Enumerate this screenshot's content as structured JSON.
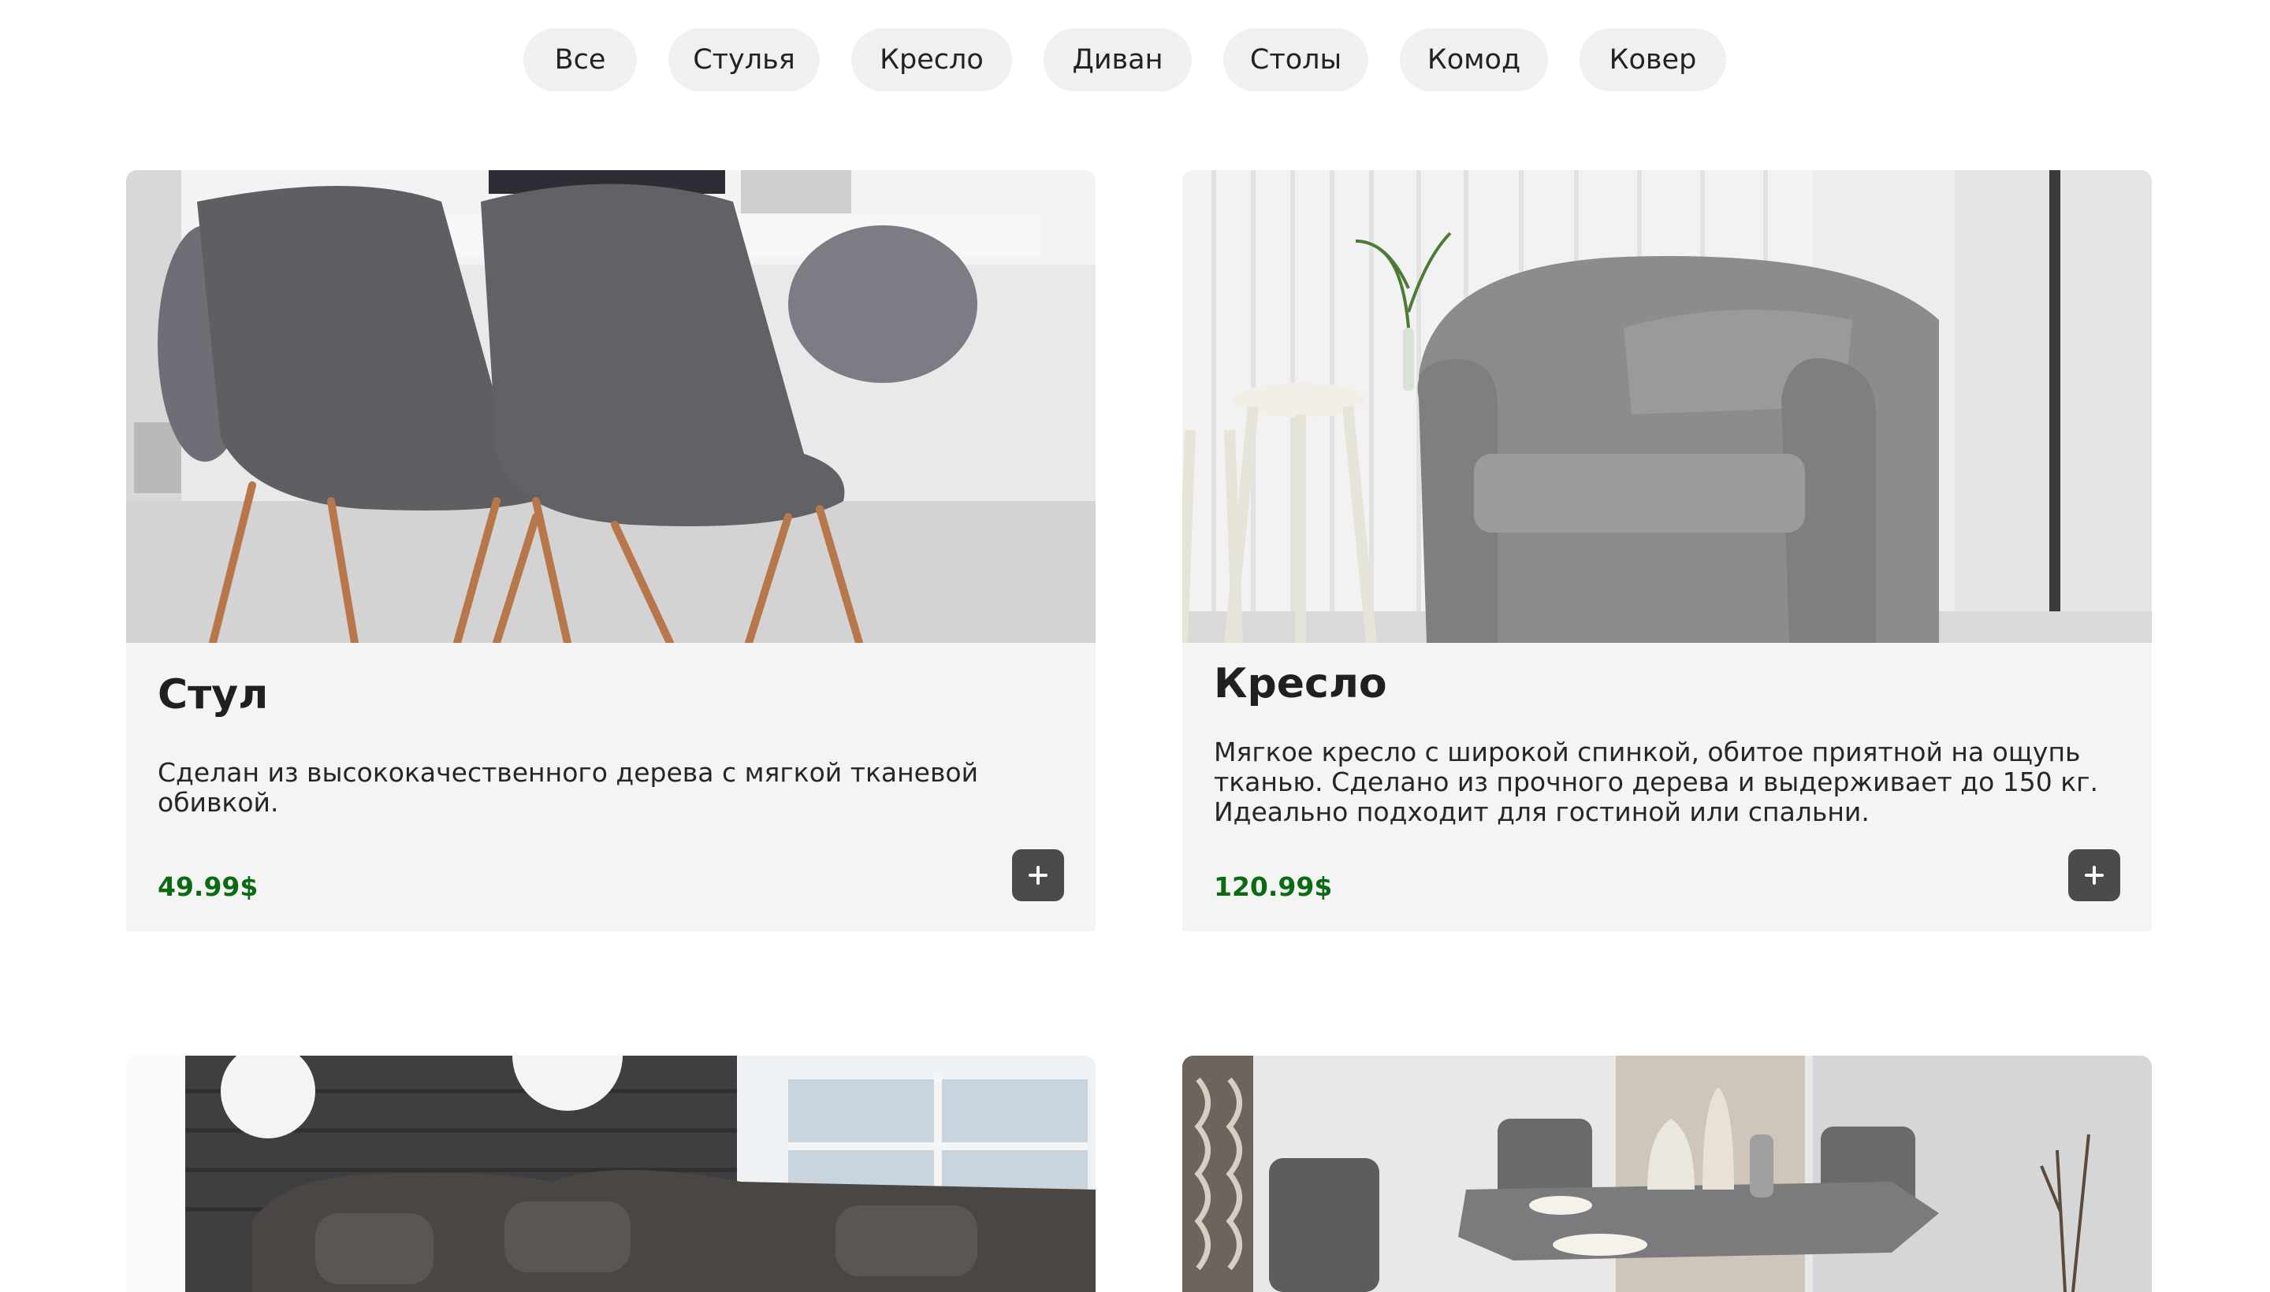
{
  "filters": [
    "Все",
    "Стулья",
    "Кресло",
    "Диван",
    "Столы",
    "Комод",
    "Ковер"
  ],
  "products": [
    {
      "name": "Стул",
      "description": "Сделан из высококачественного дерева с мягкой тканевой обивкой.",
      "price": "49.99$",
      "add_label": "+"
    },
    {
      "name": "Кресло",
      "description": "Мягкое кресло с широкой спинкой, обитое приятной на ощупь тканью. Сделано из прочного дерева и выдерживает до 150 кг. Идеально подходит для гостиной или спальни.",
      "price": "120.99$",
      "add_label": "+"
    }
  ],
  "colors": {
    "chip_bg": "#f0f0f0",
    "card_bg": "#f4f4f4",
    "price": "#0a6b12",
    "add_button": "#4b4b4b"
  }
}
